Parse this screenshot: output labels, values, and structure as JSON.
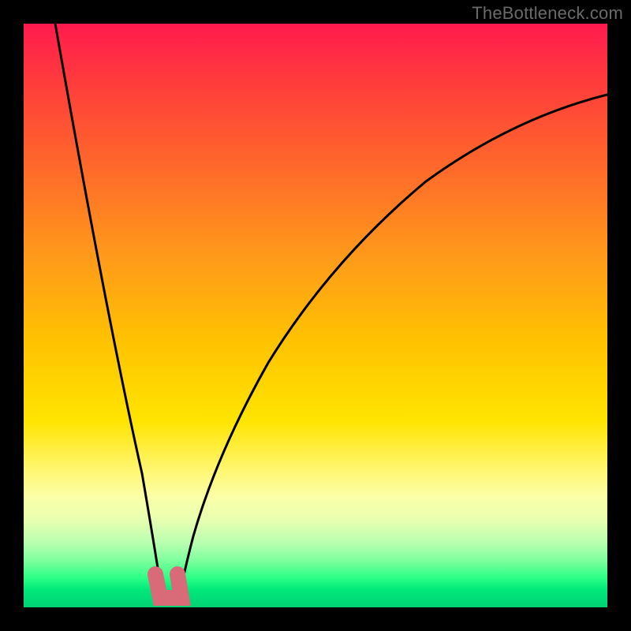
{
  "watermark": "TheBottleneck.com",
  "chart_data": {
    "type": "line",
    "title": "",
    "xlabel": "",
    "ylabel": "",
    "xlim": [
      0,
      100
    ],
    "ylim": [
      0,
      100
    ],
    "grid": false,
    "legend": false,
    "background_gradient": [
      "#ff1a4d",
      "#ff9a1a",
      "#ffe400",
      "#00d474"
    ],
    "series": [
      {
        "name": "bottleneck-curve",
        "type": "line",
        "x": [
          5,
          8,
          11,
          14,
          17,
          20,
          22,
          23,
          24,
          26,
          28,
          30,
          33,
          37,
          42,
          48,
          55,
          63,
          72,
          82,
          92,
          100
        ],
        "values": [
          100,
          88,
          75,
          62,
          48,
          33,
          18,
          8,
          3,
          3,
          8,
          16,
          28,
          40,
          51,
          60,
          68,
          74,
          79,
          83,
          86,
          88
        ]
      }
    ],
    "markers": [
      {
        "name": "optimal-range-marker",
        "x_start": 22,
        "x_end": 26,
        "y": 2,
        "color": "#d96a78"
      }
    ]
  }
}
